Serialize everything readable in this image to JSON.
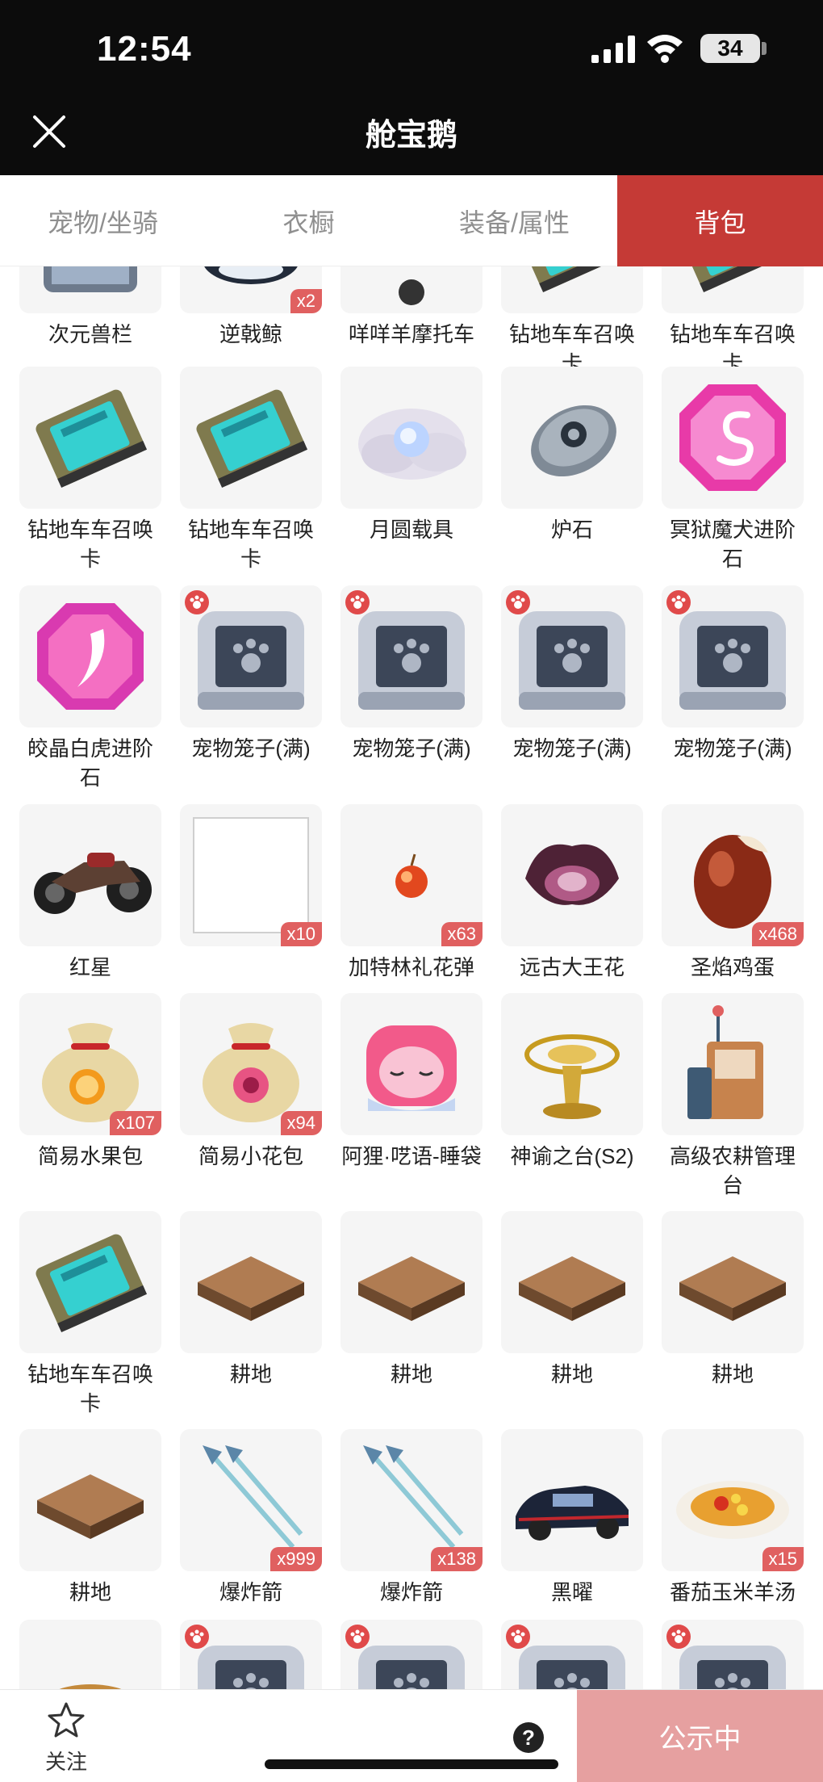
{
  "status_bar": {
    "time": "12:54",
    "battery": "34"
  },
  "header": {
    "title": "舱宝鹅"
  },
  "tabs": [
    {
      "label": "宠物/坐骑",
      "active": false
    },
    {
      "label": "衣橱",
      "active": false
    },
    {
      "label": "装备/属性",
      "active": false
    },
    {
      "label": "背包",
      "active": true
    }
  ],
  "items": [
    {
      "name": "次元兽栏",
      "badge": null,
      "pet": false,
      "icon": "cage-icon"
    },
    {
      "name": "逆戟鲸",
      "badge": "x2",
      "pet": false,
      "icon": "whale-icon"
    },
    {
      "name": "咩咩羊摩托车",
      "badge": null,
      "pet": false,
      "icon": "motorcycle-icon"
    },
    {
      "name": "钻地车车召唤卡",
      "badge": null,
      "pet": false,
      "icon": "summon-card-icon"
    },
    {
      "name": "钻地车车召唤卡",
      "badge": null,
      "pet": false,
      "icon": "summon-card-icon"
    },
    {
      "name": "钻地车车召唤卡",
      "badge": null,
      "pet": false,
      "icon": "summon-card-icon"
    },
    {
      "name": "钻地车车召唤卡",
      "badge": null,
      "pet": false,
      "icon": "summon-card-icon"
    },
    {
      "name": "月圆载具",
      "badge": null,
      "pet": false,
      "icon": "moon-cloud-icon"
    },
    {
      "name": "炉石",
      "badge": null,
      "pet": false,
      "icon": "hearthstone-icon"
    },
    {
      "name": "冥狱魔犬进阶石",
      "badge": null,
      "pet": false,
      "icon": "gem-s-icon"
    },
    {
      "name": "皎晶白虎进阶石",
      "badge": null,
      "pet": false,
      "icon": "gem-claw-icon"
    },
    {
      "name": "宠物笼子(满)",
      "badge": null,
      "pet": true,
      "icon": "pet-cage-icon"
    },
    {
      "name": "宠物笼子(满)",
      "badge": null,
      "pet": true,
      "icon": "pet-cage-icon"
    },
    {
      "name": "宠物笼子(满)",
      "badge": null,
      "pet": true,
      "icon": "pet-cage-icon"
    },
    {
      "name": "宠物笼子(满)",
      "badge": null,
      "pet": true,
      "icon": "pet-cage-icon"
    },
    {
      "name": "红星",
      "badge": null,
      "pet": false,
      "icon": "motorbike-icon"
    },
    {
      "name": "",
      "badge": "x10",
      "pet": false,
      "icon": "blank-icon"
    },
    {
      "name": "加特林礼花弹",
      "badge": "x63",
      "pet": false,
      "icon": "firework-icon"
    },
    {
      "name": "远古大王花",
      "badge": null,
      "pet": false,
      "icon": "flower-icon"
    },
    {
      "name": "圣焰鸡蛋",
      "badge": "x468",
      "pet": false,
      "icon": "egg-icon"
    },
    {
      "name": "简易水果包",
      "badge": "x107",
      "pet": false,
      "icon": "fruit-bag-icon"
    },
    {
      "name": "简易小花包",
      "badge": "x94",
      "pet": false,
      "icon": "flower-bag-icon"
    },
    {
      "name": "阿狸·呓语-睡袋",
      "badge": null,
      "pet": false,
      "icon": "sleeping-bag-icon"
    },
    {
      "name": "神谕之台(S2)",
      "badge": null,
      "pet": false,
      "icon": "oracle-stand-icon"
    },
    {
      "name": "高级农耕管理台",
      "badge": null,
      "pet": false,
      "icon": "farm-console-icon"
    },
    {
      "name": "钻地车车召唤卡",
      "badge": null,
      "pet": false,
      "icon": "summon-card-icon"
    },
    {
      "name": "耕地",
      "badge": null,
      "pet": false,
      "icon": "farmland-icon"
    },
    {
      "name": "耕地",
      "badge": null,
      "pet": false,
      "icon": "farmland-icon"
    },
    {
      "name": "耕地",
      "badge": null,
      "pet": false,
      "icon": "farmland-icon"
    },
    {
      "name": "耕地",
      "badge": null,
      "pet": false,
      "icon": "farmland-icon"
    },
    {
      "name": "耕地",
      "badge": null,
      "pet": false,
      "icon": "farmland-icon"
    },
    {
      "name": "爆炸箭",
      "badge": "x999",
      "pet": false,
      "icon": "arrow-icon"
    },
    {
      "name": "爆炸箭",
      "badge": "x138",
      "pet": false,
      "icon": "arrow-icon"
    },
    {
      "name": "黑曜",
      "badge": null,
      "pet": false,
      "icon": "car-icon"
    },
    {
      "name": "番茄玉米羊汤",
      "badge": "x15",
      "pet": false,
      "icon": "soup-icon"
    },
    {
      "name": "",
      "badge": null,
      "pet": false,
      "icon": "stump-icon"
    },
    {
      "name": "",
      "badge": null,
      "pet": true,
      "icon": "pet-cage-icon"
    },
    {
      "name": "",
      "badge": null,
      "pet": true,
      "icon": "pet-cage-icon"
    },
    {
      "name": "",
      "badge": null,
      "pet": true,
      "icon": "pet-cage-icon"
    },
    {
      "name": "",
      "badge": null,
      "pet": true,
      "icon": "pet-cage-icon"
    }
  ],
  "bottom_bar": {
    "follow_label": "关注",
    "help_label": "?",
    "publish_label": "公示中"
  },
  "colors": {
    "accent": "#c53a36",
    "publish": "#e6a0a0",
    "badge": "#e06060"
  }
}
